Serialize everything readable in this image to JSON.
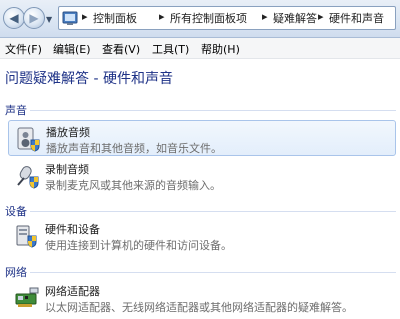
{
  "breadcrumb": [
    "控制面板",
    "所有控制面板项",
    "疑难解答",
    "硬件和声音"
  ],
  "menu": [
    "文件(F)",
    "编辑(E)",
    "查看(V)",
    "工具(T)",
    "帮助(H)"
  ],
  "page_title": "问题疑难解答 - 硬件和声音",
  "sections": {
    "sound": {
      "header": "声音",
      "items": [
        {
          "title": "播放音频",
          "desc": "播放声音和其他音频，如音乐文件。",
          "icon": "speaker-shield-icon"
        },
        {
          "title": "录制音频",
          "desc": "录制麦克风或其他来源的音频输入。",
          "icon": "microphone-shield-icon"
        }
      ]
    },
    "device": {
      "header": "设备",
      "items": [
        {
          "title": "硬件和设备",
          "desc": "使用连接到计算机的硬件和访问设备。",
          "icon": "device-shield-icon"
        }
      ]
    },
    "network": {
      "header": "网络",
      "items": [
        {
          "title": "网络适配器",
          "desc": "以太网适配器、无线网络适配器或其他网络适配器的疑难解答。",
          "icon": "network-adapter-icon"
        }
      ]
    }
  },
  "colors": {
    "section_header": "#1e3287",
    "selected_bg": "#e3eefb",
    "selected_border": "#a9c4ea"
  }
}
